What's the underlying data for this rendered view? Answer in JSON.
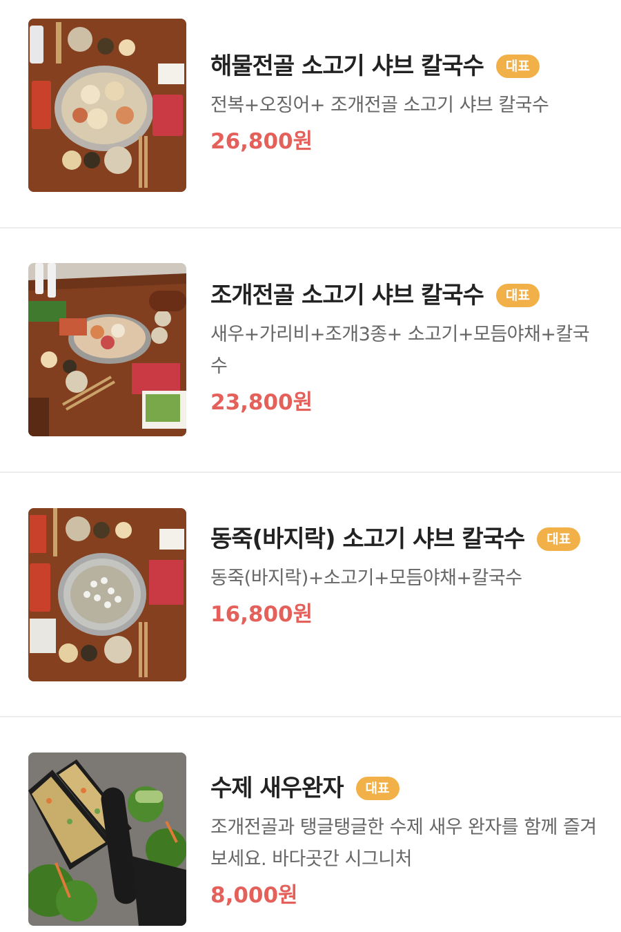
{
  "menu": {
    "items": [
      {
        "name": "해물전골 소고기 샤브 칼국수",
        "badge": "대표",
        "description": "전복+오징어+ 조개전골 소고기 샤브 칼국수",
        "price": "26,800원"
      },
      {
        "name": "조개전골 소고기 샤브 칼국수",
        "badge": "대표",
        "description": "새우+가리비+조개3종+ 소고기+모듬야채+칼국수",
        "price": "23,800원"
      },
      {
        "name": "동죽(바지락) 소고기 샤브 칼국수",
        "badge": "대표",
        "description": "동죽(바지락)+소고기+모듬야채+칼국수",
        "price": "16,800원"
      },
      {
        "name": "수제 새우완자",
        "badge": "대표",
        "description": "조개전골과 탱글탱글한 수제 새우 완자를 함께 즐겨보세요. 바다곳간 시그니처",
        "price": "8,000원"
      }
    ]
  },
  "colors": {
    "badge": "#f2b049",
    "price": "#e4605a",
    "title": "#222222",
    "description": "#666666"
  }
}
